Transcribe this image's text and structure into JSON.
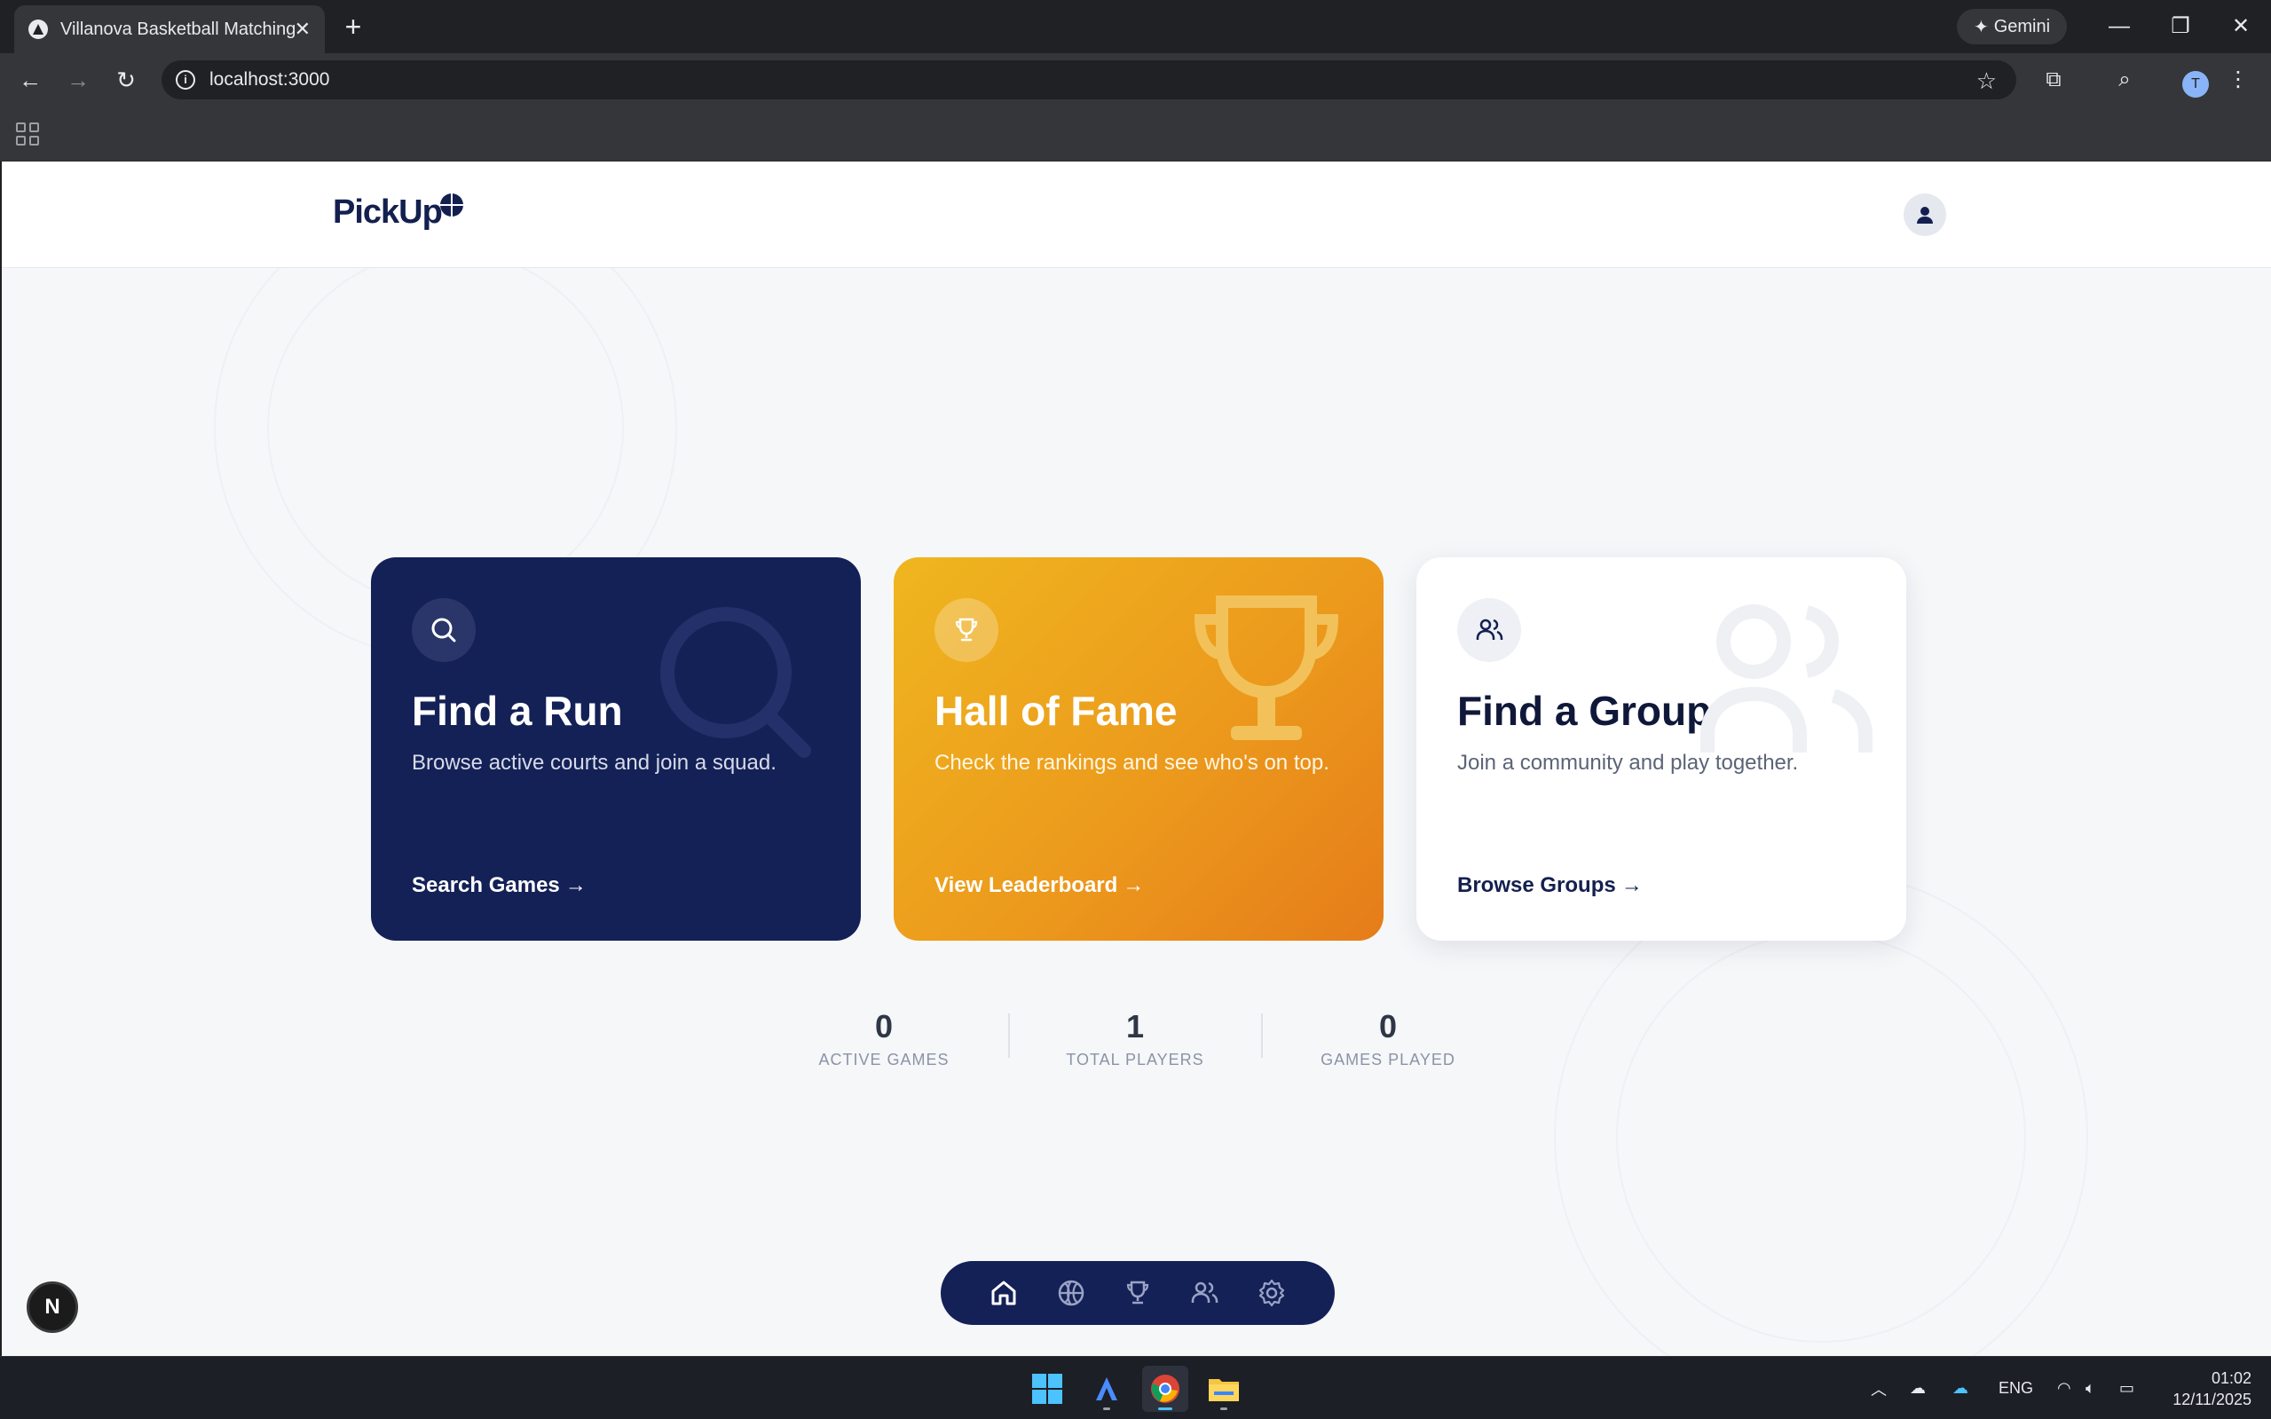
{
  "browser": {
    "tab_title": "Villanova Basketball Matching",
    "tab_close": "✕",
    "new_tab": "+",
    "gemini_label": "Gemini",
    "url": "localhost:3000",
    "profile_initial": "T"
  },
  "app": {
    "logo_text": "PickUp"
  },
  "cards": [
    {
      "title": "Find a Run",
      "description": "Browse active courts and join a squad.",
      "link": "Search Games",
      "icon": "search-icon"
    },
    {
      "title": "Hall of Fame",
      "description": "Check the rankings and see who's on top.",
      "link": "View Leaderboard",
      "icon": "trophy-icon"
    },
    {
      "title": "Find a Group",
      "description": "Join a community and play together.",
      "link": "Browse Groups",
      "icon": "users-icon"
    }
  ],
  "stats": [
    {
      "value": "0",
      "label": "ACTIVE GAMES"
    },
    {
      "value": "1",
      "label": "TOTAL PLAYERS"
    },
    {
      "value": "0",
      "label": "GAMES PLAYED"
    }
  ],
  "bottom_nav": [
    "home-icon",
    "basketball-icon",
    "trophy-icon",
    "users-icon",
    "settings-icon"
  ],
  "dev_badge": "N",
  "taskbar": {
    "language": "ENG",
    "time": "01:02",
    "date": "12/11/2025"
  },
  "colors": {
    "navy": "#142157",
    "orange": "#ec9a1c",
    "page_bg": "#f6f7f9"
  }
}
